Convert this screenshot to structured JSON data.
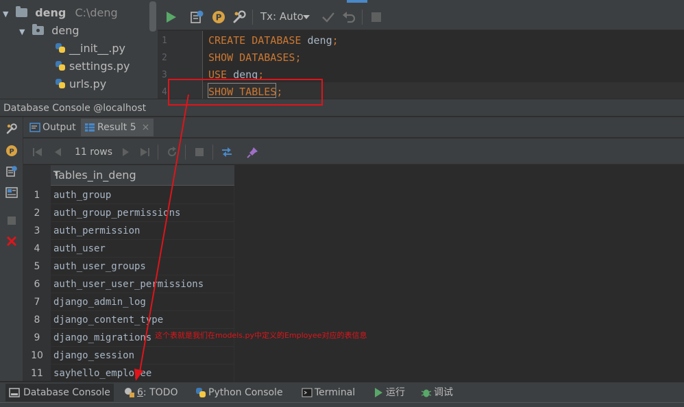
{
  "project_tree": {
    "root_name": "deng",
    "root_path": "C:\\deng",
    "package_name": "deng",
    "files": [
      "__init__.py",
      "settings.py",
      "urls.py"
    ]
  },
  "editor_toolbar": {
    "tx_mode": "Tx: Auto"
  },
  "editor": {
    "lines": [
      {
        "num": "1",
        "keyword": "CREATE DATABASE",
        "ident": " deng",
        "semi": ";"
      },
      {
        "num": "2",
        "keyword": "SHOW DATABASES",
        "ident": "",
        "semi": ";"
      },
      {
        "num": "3",
        "keyword": "USE",
        "ident": " deng",
        "semi": ";"
      },
      {
        "num": "4",
        "keyword": "SHOW TABLES",
        "ident": "",
        "semi": ";"
      }
    ]
  },
  "console": {
    "title": "Database Console @localhost",
    "tabs": {
      "output": "Output",
      "result": "Result 5",
      "close": "×"
    },
    "row_count": "11 rows"
  },
  "grid": {
    "column_header": "Tables_in_deng",
    "sort_glyph": "⬍",
    "rows": [
      {
        "n": "1",
        "v": "auth_group"
      },
      {
        "n": "2",
        "v": "auth_group_permissions"
      },
      {
        "n": "3",
        "v": "auth_permission"
      },
      {
        "n": "4",
        "v": "auth_user"
      },
      {
        "n": "5",
        "v": "auth_user_groups"
      },
      {
        "n": "6",
        "v": "auth_user_user_permissions"
      },
      {
        "n": "7",
        "v": "django_admin_log"
      },
      {
        "n": "8",
        "v": "django_content_type"
      },
      {
        "n": "9",
        "v": "django_migrations"
      },
      {
        "n": "10",
        "v": "django_session"
      },
      {
        "n": "11",
        "v": "sayhello_employee"
      }
    ]
  },
  "annotation": {
    "text": "这个表就是我们在models.py中定义的Employee对应的表信息",
    "color": "#e0141a"
  },
  "bottom_tabs": {
    "database_console": "Database Console",
    "todo_num": "6",
    "todo_label": ": TODO",
    "python_console": "Python Console",
    "terminal": "Terminal",
    "run": "运行",
    "debug": "调试"
  },
  "colors": {
    "keyword": "#cc7832",
    "identifier": "#a9b7c6",
    "run_green": "#59a869",
    "stop_red": "#e0141a",
    "panel_bg": "#3c3f41",
    "editor_bg": "#2b2b2b"
  },
  "icons": [
    "run-icon",
    "history-icon",
    "parameter-icon",
    "settings-wrench-icon",
    "commit-icon",
    "rollback-icon",
    "stop-icon",
    "first-page-icon",
    "prev-page-icon",
    "next-page-icon",
    "last-page-icon",
    "refresh-icon",
    "cancel-icon",
    "compare-icon",
    "pin-icon",
    "close-icon"
  ]
}
